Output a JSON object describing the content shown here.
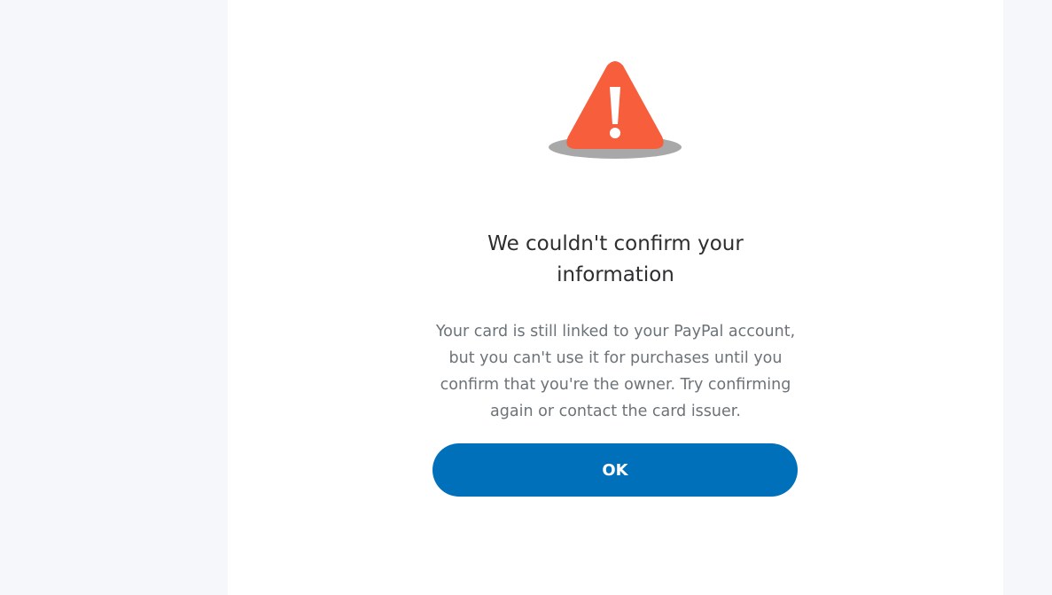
{
  "dialog": {
    "icon": "warning-triangle-icon",
    "title_lines": [
      "We couldn't confirm your",
      "information"
    ],
    "message_lines": [
      "Your card is still linked to your PayPal account,",
      "but you can't use it for purchases until you",
      "confirm that you're the owner. Try confirming",
      "again or contact the card issuer."
    ],
    "ok_label": "OK"
  },
  "colors": {
    "page_background": "#f5f7fa",
    "card_background": "#ffffff",
    "warning_orange": "#f65e3c",
    "button_blue": "#0070ba",
    "title_text": "#2c2e2f",
    "body_text": "#6c7378"
  }
}
